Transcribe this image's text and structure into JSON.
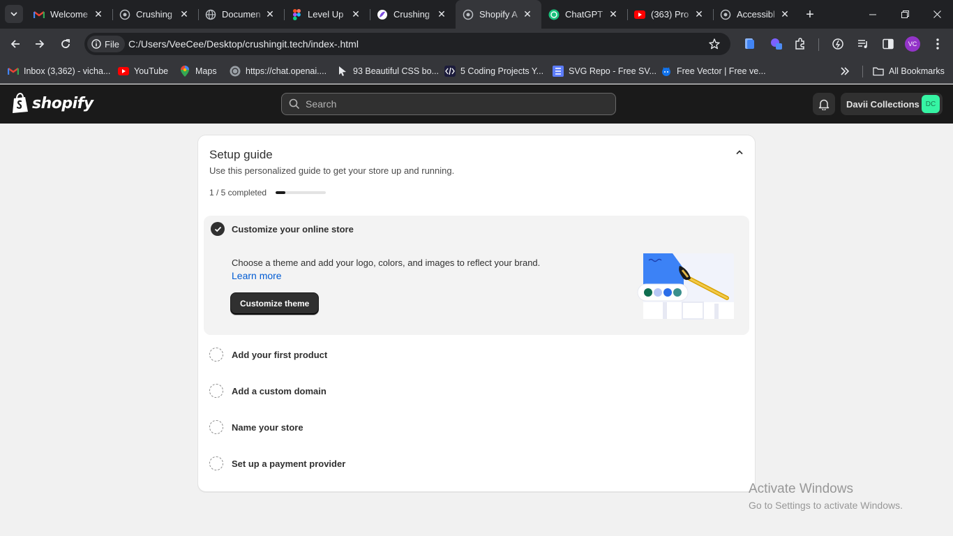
{
  "browser": {
    "tabs": [
      {
        "title": "Welcome",
        "icon": "gmail-icon"
      },
      {
        "title": "Crushing",
        "icon": "globe-icon"
      },
      {
        "title": "Documen",
        "icon": "globe-icon"
      },
      {
        "title": "Level Up",
        "icon": "figma-icon"
      },
      {
        "title": "Crushing",
        "icon": "purple-logo-icon"
      },
      {
        "title": "Shopify A",
        "icon": "globe-icon",
        "active": true
      },
      {
        "title": "ChatGPT",
        "icon": "chatgpt-icon"
      },
      {
        "title": "(363) Pro",
        "icon": "youtube-icon"
      },
      {
        "title": "Accessibl",
        "icon": "globe-icon"
      }
    ],
    "address": {
      "scheme_label": "File",
      "url": "C:/Users/VeeCee/Desktop/crushingit.tech/index-.html"
    },
    "profile_initials": "VC",
    "bookmarks": [
      {
        "label": "Inbox (3,362) - vicha...",
        "icon": "gmail-icon"
      },
      {
        "label": "YouTube",
        "icon": "youtube-icon"
      },
      {
        "label": "Maps",
        "icon": "maps-icon"
      },
      {
        "label": "https://chat.openai....",
        "icon": "chatgpt-icon"
      },
      {
        "label": "93 Beautiful CSS bo...",
        "icon": "cursor-icon"
      },
      {
        "label": "5 Coding Projects Y...",
        "icon": "code-icon"
      },
      {
        "label": "SVG Repo - Free SV...",
        "icon": "svgrepo-icon"
      },
      {
        "label": "Free Vector | Free ve...",
        "icon": "freepik-icon"
      }
    ],
    "all_bookmarks_label": "All Bookmarks"
  },
  "shopify": {
    "logo_text": "shopify",
    "search_placeholder": "Search",
    "store_name": "Davii Collections",
    "store_initials": "DC"
  },
  "setup_guide": {
    "title": "Setup guide",
    "subtitle": "Use this personalized guide to get your store up and running.",
    "progress_label": "1 / 5 completed",
    "progress_fraction": 0.2,
    "active_step": {
      "title": "Customize your online store",
      "description": "Choose a theme and add your logo, colors, and images to reflect your brand.",
      "link_label": "Learn more",
      "button_label": "Customize theme"
    },
    "steps": [
      {
        "title": "Add your first product"
      },
      {
        "title": "Add a custom domain"
      },
      {
        "title": "Name your store"
      },
      {
        "title": "Set up a payment provider"
      }
    ]
  },
  "watermark": {
    "line1": "Activate Windows",
    "line2": "Go to Settings to activate Windows."
  }
}
